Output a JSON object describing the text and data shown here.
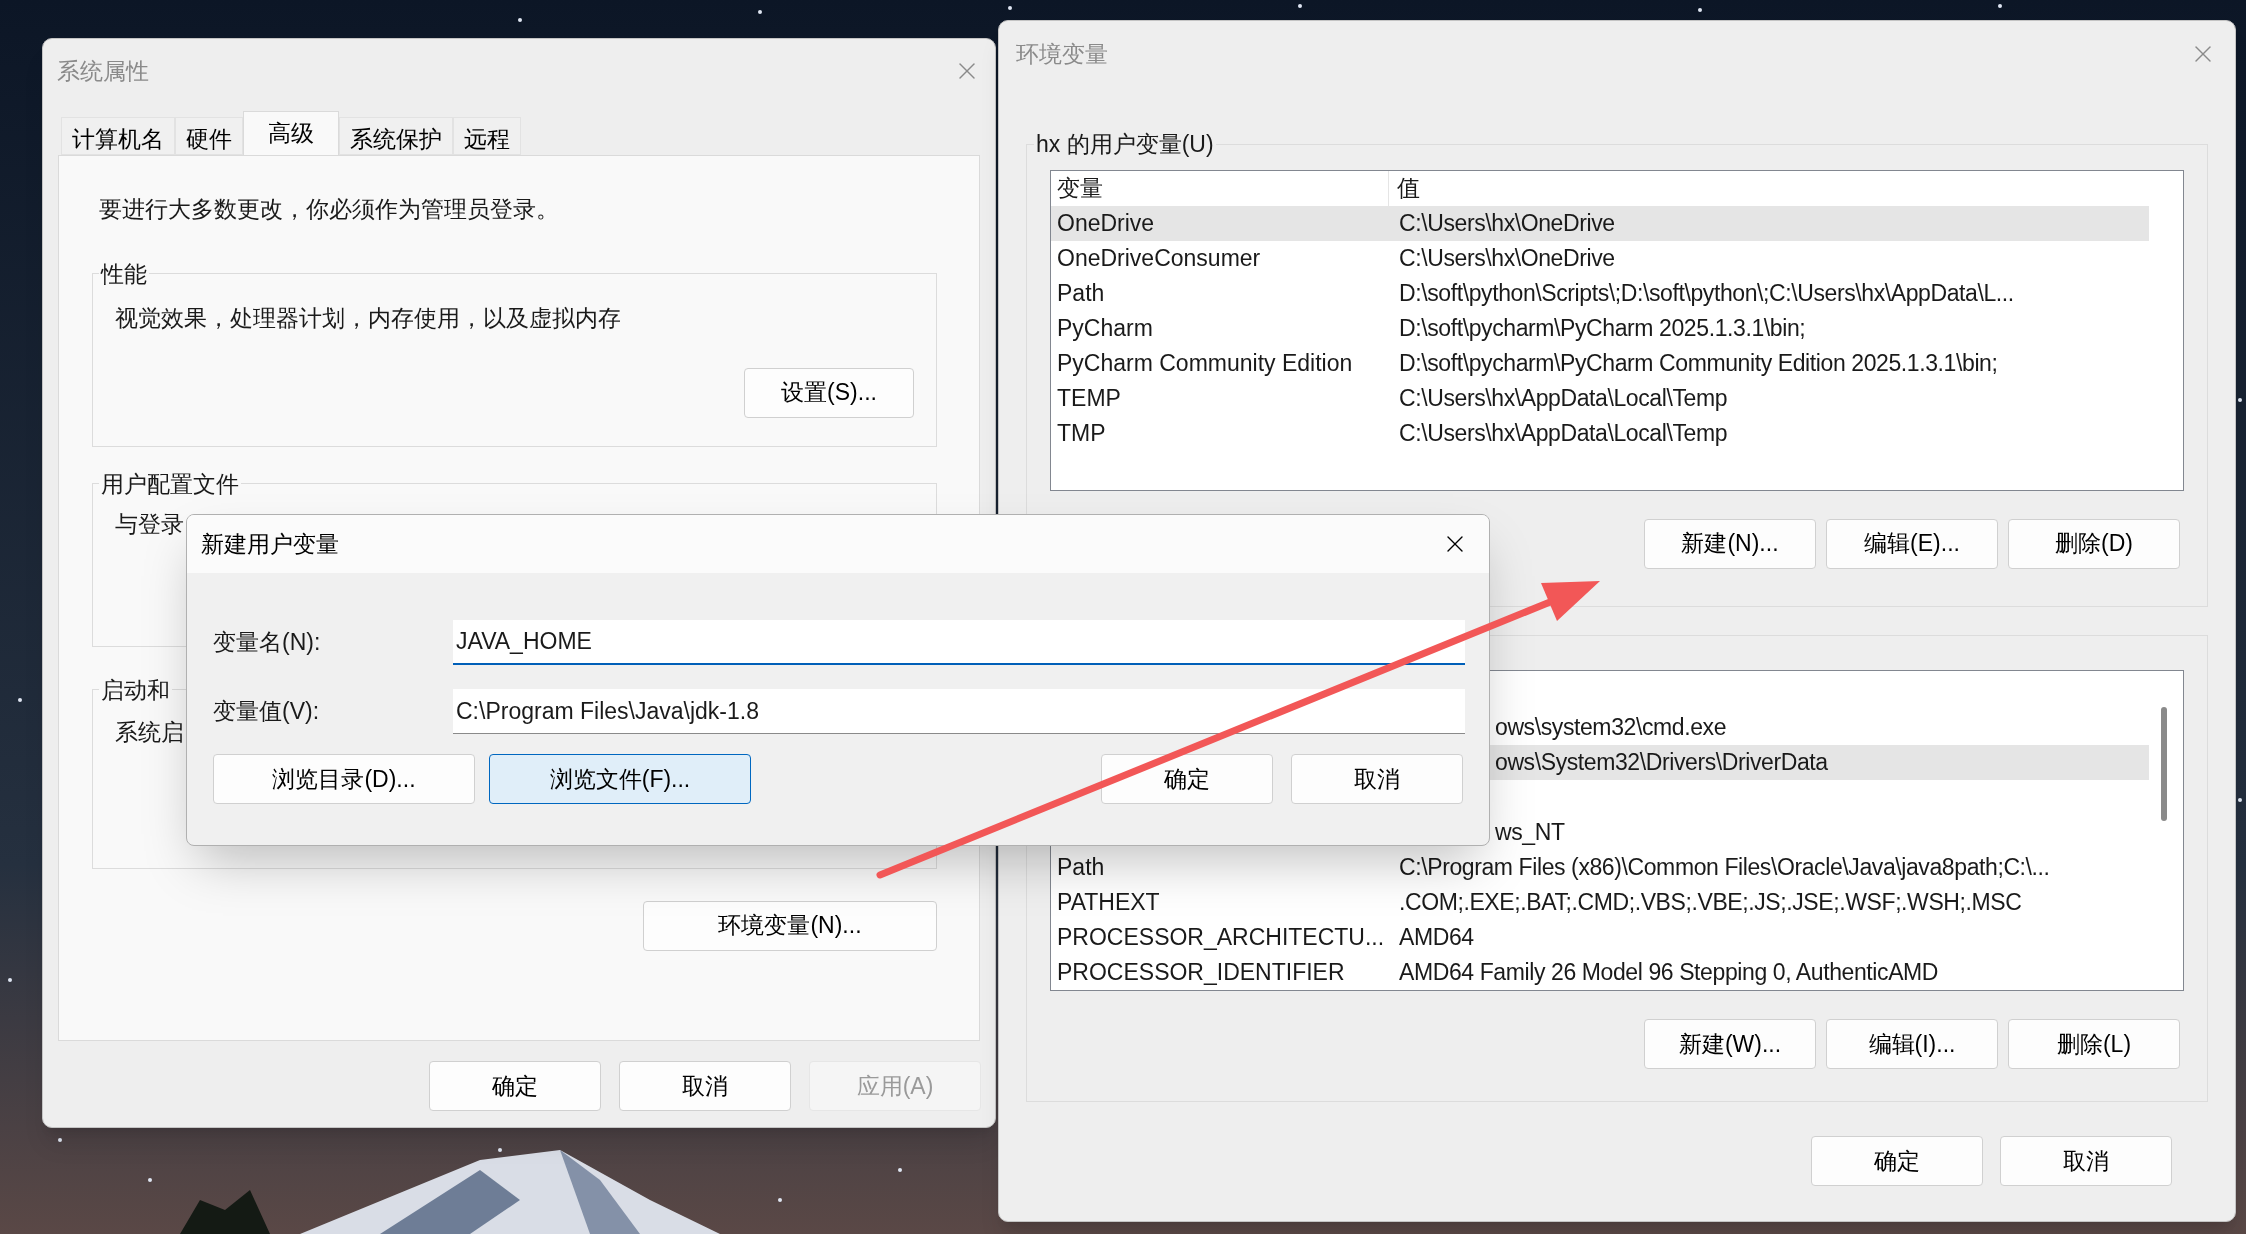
{
  "system_properties": {
    "title": "系统属性",
    "tabs": [
      {
        "label": "计算机名",
        "selected": false
      },
      {
        "label": "硬件",
        "selected": false
      },
      {
        "label": "高级",
        "selected": true
      },
      {
        "label": "系统保护",
        "selected": false
      },
      {
        "label": "远程",
        "selected": false
      }
    ],
    "notice": "要进行大多数更改，你必须作为管理员登录。",
    "groups": [
      {
        "label": "性能",
        "text": "视觉效果，处理器计划，内存使用，以及虚拟内存",
        "button": "设置(S)..."
      },
      {
        "label": "用户配置文件",
        "text": "与登录"
      },
      {
        "label": "启动和",
        "text": "系统启"
      }
    ],
    "env_button": "环境变量(N)...",
    "buttons": [
      {
        "label": "确定",
        "disabled": false
      },
      {
        "label": "取消",
        "disabled": false
      },
      {
        "label": "应用(A)",
        "disabled": true
      }
    ]
  },
  "environment_variables": {
    "title": "环境变量",
    "user_group": {
      "label": "hx 的用户变量(U)",
      "columns": [
        "变量",
        "值"
      ],
      "rows": [
        {
          "name": "OneDrive",
          "value": "C:\\Users\\hx\\OneDrive",
          "selected": true
        },
        {
          "name": "OneDriveConsumer",
          "value": "C:\\Users\\hx\\OneDrive",
          "selected": false
        },
        {
          "name": "Path",
          "value": "D:\\soft\\python\\Scripts\\;D:\\soft\\python\\;C:\\Users\\hx\\AppData\\L...",
          "selected": false
        },
        {
          "name": "PyCharm",
          "value": "D:\\soft\\pycharm\\PyCharm 2025.1.3.1\\bin;",
          "selected": false
        },
        {
          "name": "PyCharm Community Edition",
          "value": "D:\\soft\\pycharm\\PyCharm Community Edition 2025.1.3.1\\bin;",
          "selected": false
        },
        {
          "name": "TEMP",
          "value": "C:\\Users\\hx\\AppData\\Local\\Temp",
          "selected": false
        },
        {
          "name": "TMP",
          "value": "C:\\Users\\hx\\AppData\\Local\\Temp",
          "selected": false
        }
      ],
      "buttons": [
        "新建(N)...",
        "编辑(E)...",
        "删除(D)"
      ]
    },
    "system_group": {
      "rows": [
        {
          "kind": "clipped",
          "value": "ows\\system32\\cmd.exe",
          "selected": false
        },
        {
          "kind": "clipped",
          "value": "ows\\System32\\Drivers\\DriverData",
          "selected": true
        },
        {
          "kind": "hidden"
        },
        {
          "kind": "clipped",
          "value": "ws_NT",
          "selected": false
        },
        {
          "kind": "full",
          "name": "Path",
          "value": "C:\\Program Files (x86)\\Common Files\\Oracle\\Java\\java8path;C:\\...",
          "selected": false
        },
        {
          "kind": "full",
          "name": "PATHEXT",
          "value": ".COM;.EXE;.BAT;.CMD;.VBS;.VBE;.JS;.JSE;.WSF;.WSH;.MSC",
          "selected": false
        },
        {
          "kind": "full",
          "name": "PROCESSOR_ARCHITECTU...",
          "value": "AMD64",
          "selected": false
        },
        {
          "kind": "full",
          "name": "PROCESSOR_IDENTIFIER",
          "value": "AMD64 Family 26 Model 96 Stepping 0, AuthenticAMD",
          "selected": false
        }
      ],
      "buttons": [
        "新建(W)...",
        "编辑(I)...",
        "删除(L)"
      ]
    },
    "buttons": [
      "确定",
      "取消"
    ]
  },
  "new_variable_dialog": {
    "title": "新建用户变量",
    "fields": [
      {
        "label": "变量名(N):",
        "value": "JAVA_HOME",
        "focused": true
      },
      {
        "label": "变量值(V):",
        "value": "C:\\Program Files\\Java\\jdk-1.8",
        "focused": false
      }
    ],
    "buttons": [
      {
        "label": "浏览目录(D)...",
        "hovered": false
      },
      {
        "label": "浏览文件(F)...",
        "hovered": true
      },
      {
        "label": "确定",
        "hovered": false
      },
      {
        "label": "取消",
        "hovered": false
      }
    ]
  }
}
